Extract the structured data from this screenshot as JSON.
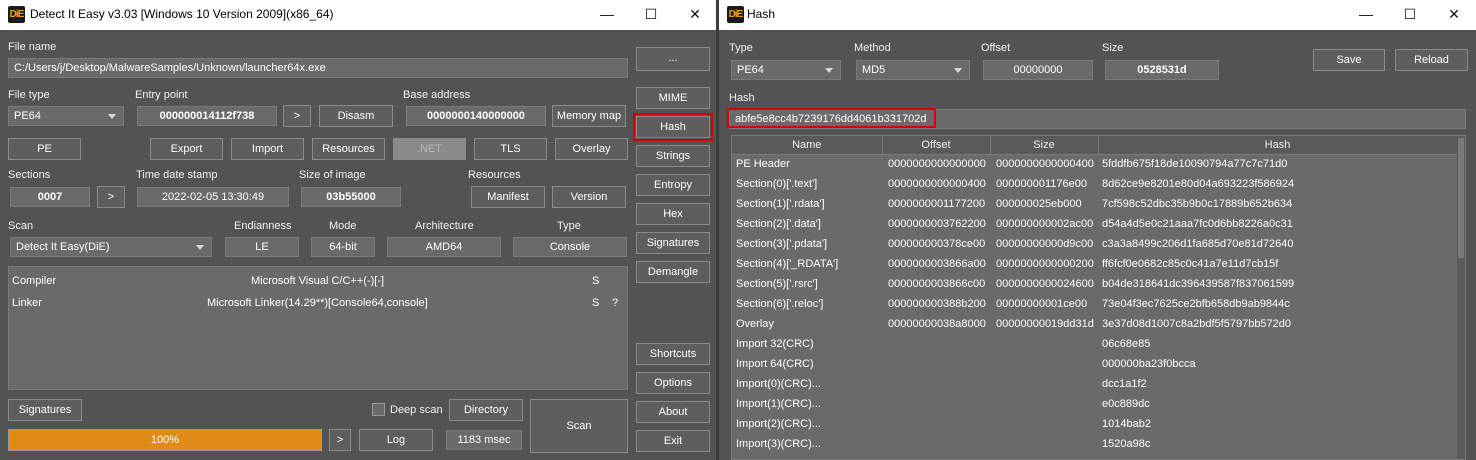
{
  "left": {
    "title": "Detect It Easy v3.03 [Windows 10 Version 2009](x86_64)",
    "app_icon": "DiE",
    "controls": {
      "minimize": "—",
      "maximize": "☐",
      "close": "✕"
    },
    "file_name": {
      "label": "File name",
      "value": "C:/Users/j/Desktop/MalwareSamples/Unknown/launcher64x.exe"
    },
    "file_type": {
      "label": "File type",
      "value": "PE64"
    },
    "entry_point": {
      "label": "Entry point",
      "value": "000000014112f738",
      "go": ">",
      "disasm": "Disasm"
    },
    "base_address": {
      "label": "Base address",
      "value": "0000000140000000",
      "memory_map": "Memory map"
    },
    "row_buttons": {
      "pe": "PE",
      "export": "Export",
      "import": "Import",
      "resources": "Resources",
      "net": ".NET",
      "tls": "TLS",
      "overlay": "Overlay"
    },
    "sections": {
      "label": "Sections",
      "value": "0007",
      "go": ">"
    },
    "time_date_stamp": {
      "label": "Time date stamp",
      "value": "2022-02-05 13:30:49"
    },
    "size_of_image": {
      "label": "Size of image",
      "value": "03b55000"
    },
    "resources": {
      "label": "Resources",
      "manifest": "Manifest",
      "version": "Version"
    },
    "scan": {
      "label": "Scan",
      "value": "Detect It Easy(DiE)"
    },
    "endianness": {
      "label": "Endianness",
      "value": "LE"
    },
    "mode": {
      "label": "Mode",
      "value": "64-bit"
    },
    "architecture": {
      "label": "Architecture",
      "value": "AMD64"
    },
    "type": {
      "label": "Type",
      "value": "Console"
    },
    "results": [
      {
        "kind": "Compiler",
        "name": "Microsoft Visual C/C++(-)[-]",
        "flag": "S",
        "extra": ""
      },
      {
        "kind": "Linker",
        "name": "Microsoft Linker(14.29**)[Console64,console]",
        "flag": "S",
        "extra": "?"
      }
    ],
    "bottom": {
      "signatures": "Signatures",
      "deep_scan": "Deep scan",
      "directory": "Directory",
      "scan": "Scan",
      "progress": "100%",
      "progress_value": 1.0,
      "go": ">",
      "log": "Log",
      "time": "1183 msec"
    },
    "side_buttons": {
      "browse": "...",
      "mime": "MIME",
      "hash": "Hash",
      "strings": "Strings",
      "entropy": "Entropy",
      "hex": "Hex",
      "signatures": "Signatures",
      "demangle": "Demangle",
      "shortcuts": "Shortcuts",
      "options": "Options",
      "about": "About",
      "exit": "Exit"
    }
  },
  "right": {
    "title": "Hash",
    "app_icon": "DiE",
    "controls": {
      "minimize": "—",
      "maximize": "☐",
      "close": "✕"
    },
    "type": {
      "label": "Type",
      "value": "PE64"
    },
    "method": {
      "label": "Method",
      "value": "MD5"
    },
    "offset": {
      "label": "Offset",
      "value": "00000000"
    },
    "size": {
      "label": "Size",
      "value": "0528531d"
    },
    "save": "Save",
    "reload": "Reload",
    "hash": {
      "label": "Hash",
      "value": "abfe5e8cc4b7239176dd4061b331702d"
    },
    "table": {
      "columns": [
        "Name",
        "Offset",
        "Size",
        "Hash"
      ],
      "rows": [
        {
          "name": "PE Header",
          "offset": "0000000000000000",
          "size": "0000000000000400",
          "hash": "5fddfb675f18de10090794a77c7c71d0"
        },
        {
          "name": "Section(0)['.text']",
          "offset": "0000000000000400",
          "size": "000000001176e00",
          "hash": "8d62ce9e8201e80d04a693223f586924"
        },
        {
          "name": "Section(1)['.rdata']",
          "offset": "0000000001177200",
          "size": "000000025eb000",
          "hash": "7cf598c52dbc35b9b0c17889b652b634"
        },
        {
          "name": "Section(2)['.data']",
          "offset": "0000000003762200",
          "size": "000000000002ac00",
          "hash": "d54a4d5e0c21aaa7fc0d6bb8226a0c31"
        },
        {
          "name": "Section(3)['.pdata']",
          "offset": "000000000378ce00",
          "size": "00000000000d9c00",
          "hash": "c3a3a8499c206d1fa685d70e81d72640"
        },
        {
          "name": "Section(4)['_RDATA']",
          "offset": "0000000003866a00",
          "size": "0000000000000200",
          "hash": "ff6fcf0e0682c85c0c41a7e11d7cb15f"
        },
        {
          "name": "Section(5)['.rsrc']",
          "offset": "0000000003866c00",
          "size": "0000000000024600",
          "hash": "b04de318641dc396439587f837061599"
        },
        {
          "name": "Section(6)['.reloc']",
          "offset": "000000000388b200",
          "size": "00000000001ce00",
          "hash": "73e04f3ec7625ce2bfb658db9ab9844c"
        },
        {
          "name": "Overlay",
          "offset": "00000000038a8000",
          "size": "00000000019dd31d",
          "hash": "3e37d08d1007c8a2bdf5f5797bb572d0"
        },
        {
          "name": "Import 32(CRC)",
          "offset": "",
          "size": "",
          "hash": "06c68e85"
        },
        {
          "name": "Import 64(CRC)",
          "offset": "",
          "size": "",
          "hash": "000000ba23f0bcca"
        },
        {
          "name": "Import(0)(CRC)...",
          "offset": "",
          "size": "",
          "hash": "dcc1a1f2"
        },
        {
          "name": "Import(1)(CRC)...",
          "offset": "",
          "size": "",
          "hash": "e0c889dc"
        },
        {
          "name": "Import(2)(CRC)...",
          "offset": "",
          "size": "",
          "hash": "1014bab2"
        },
        {
          "name": "Import(3)(CRC)...",
          "offset": "",
          "size": "",
          "hash": "1520a98c"
        }
      ]
    }
  },
  "colors": {
    "background": "#535353",
    "field": "#6a6a6a",
    "progress": "#e08a17",
    "highlight": "#d40000"
  }
}
